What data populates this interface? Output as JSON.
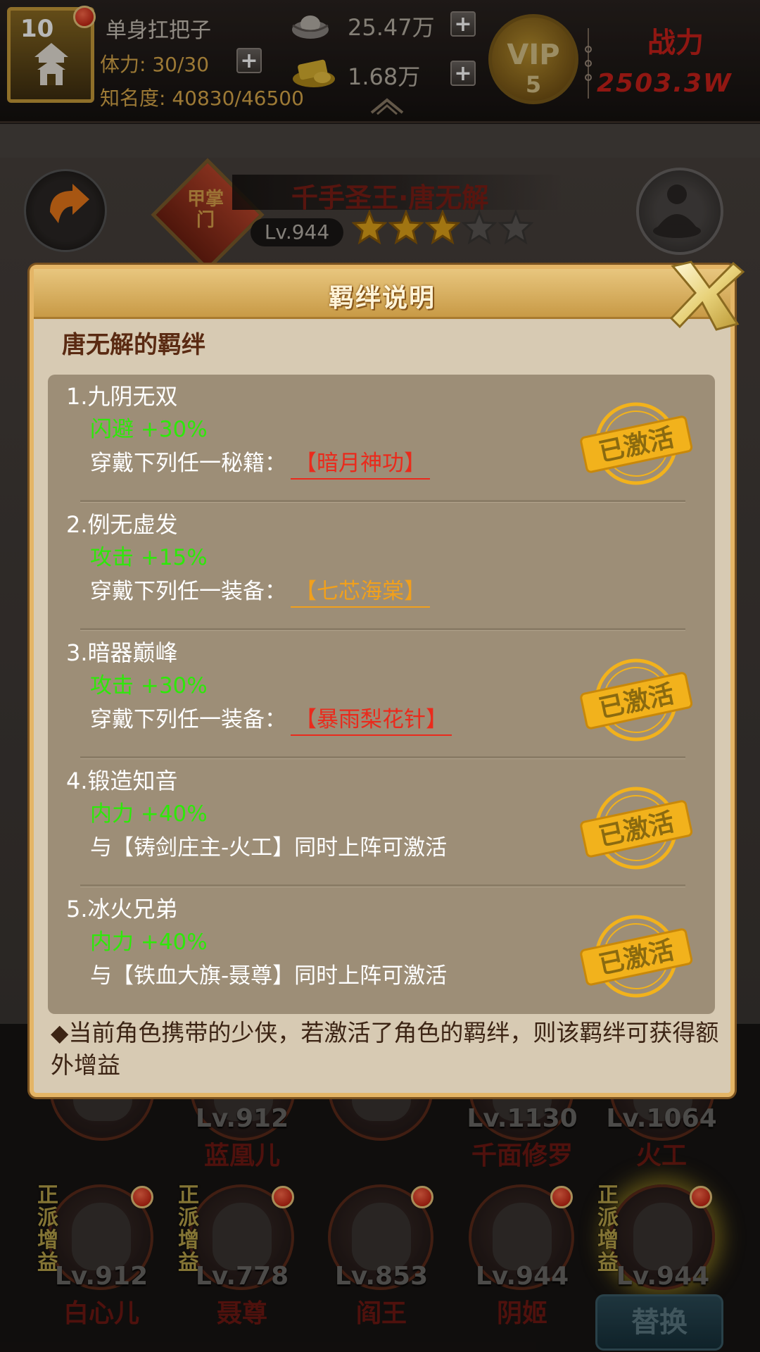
{
  "top_bar": {
    "level": "10",
    "player_name": "单身扛把子",
    "stamina": "体力: 30/30",
    "fame": "知名度: 40830/46500",
    "money": "25.47万",
    "gold": "1.68万",
    "vip_label": "VIP",
    "vip_level": "5",
    "power_label": "战力",
    "power_value": "2503.3W"
  },
  "hero": {
    "badge": "甲掌门",
    "name": "千手圣王·唐无解",
    "level": "Lv.944",
    "stars_filled": 3,
    "stars_total": 5
  },
  "popup": {
    "title": "羁绊说明",
    "subtitle": "唐无解的羁绊",
    "bonds": [
      {
        "title": "1.九阴无双",
        "bonus": "闪避 +30%",
        "req_prefix": "穿戴下列任一秘籍：",
        "item": "【暗月神功】",
        "item_color": "red",
        "activated": true
      },
      {
        "title": "2.例无虚发",
        "bonus": "攻击 +15%",
        "req_prefix": "穿戴下列任一装备：",
        "item": "【七芯海棠】",
        "item_color": "orange",
        "activated": false
      },
      {
        "title": "3.暗器巅峰",
        "bonus": "攻击 +30%",
        "req_prefix": "穿戴下列任一装备：",
        "item": "【暴雨梨花针】",
        "item_color": "red",
        "activated": true
      },
      {
        "title": "4.锻造知音",
        "bonus": "内力 +40%",
        "req_prefix": "与【铸剑庄主-火工】同时上阵可激活",
        "item": "",
        "item_color": "",
        "activated": true
      },
      {
        "title": "5.冰火兄弟",
        "bonus": "内力 +40%",
        "req_prefix": "与【铁血大旗-聂尊】同时上阵可激活",
        "item": "",
        "item_color": "",
        "activated": true
      }
    ],
    "stamp_text": "已激活",
    "footer": "◆当前角色携带的少侠，若激活了角色的羁绊，则该羁绊可获得额外增益"
  },
  "roster": {
    "row1": [
      {
        "level": "",
        "name": ""
      },
      {
        "level": "Lv.912",
        "name": "蓝凰儿"
      },
      {
        "level": "",
        "name": ""
      },
      {
        "level": "Lv.1130",
        "name": "千面修罗"
      },
      {
        "level": "Lv.1064",
        "name": "火工"
      }
    ],
    "row2": [
      {
        "level": "Lv.912",
        "name": "白心儿"
      },
      {
        "level": "Lv.778",
        "name": "聂尊"
      },
      {
        "level": "Lv.853",
        "name": "阎王"
      },
      {
        "level": "Lv.944",
        "name": "阴姬"
      },
      {
        "level": "Lv.944",
        "name": ""
      }
    ],
    "tag_text": "正派增益",
    "replace_label": "替换"
  },
  "colors": {
    "bonus_green": "#2ee80a",
    "item_red": "#ea2a1c",
    "item_orange": "#f1a01c",
    "stamp_gold": "#f2b21c",
    "popup_bg": "#d7cab3",
    "list_bg": "#9d8e77"
  }
}
